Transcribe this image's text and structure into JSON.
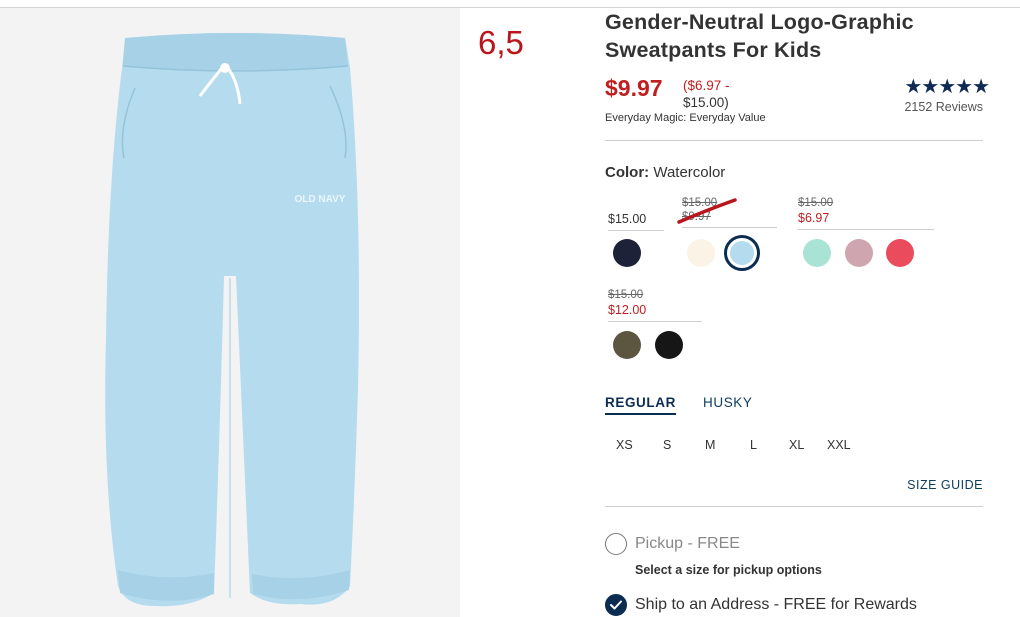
{
  "note": {
    "text": "6,5"
  },
  "product": {
    "title": "Gender-Neutral Logo-Graphic Sweatpants For Kids",
    "image_logo_text": "OLD NAVY",
    "price": "$9.97",
    "price_range_sale": "($6.97 -",
    "price_range_rest": "$15.00)",
    "tagline": "Everyday Magic: Everyday Value",
    "rating": {
      "stars": "★★★★★",
      "value": 5,
      "reviews": "2152 Reviews"
    }
  },
  "color": {
    "label": "Color:",
    "selected": "Watercolor",
    "groups": [
      {
        "regular": "$15.00"
      },
      {
        "original": "$15.00",
        "sale": "$9.97"
      },
      {
        "original": "$15.00",
        "sale": "$6.97"
      },
      {
        "original": "$15.00",
        "sale": "$12.00"
      }
    ],
    "swatches": [
      {
        "color": "#1d2238"
      },
      {
        "color": "#fbf3e6"
      },
      {
        "color": "#b5dbee",
        "selected": true
      },
      {
        "color": "#a9e3d6"
      },
      {
        "color": "#cfa6b0"
      },
      {
        "color": "#ea4b5d"
      },
      {
        "color": "#5c5640"
      },
      {
        "color": "#161616"
      }
    ]
  },
  "fit": {
    "tabs": [
      {
        "label": "REGULAR",
        "active": true
      },
      {
        "label": "HUSKY",
        "active": false
      }
    ]
  },
  "sizes": [
    "XS",
    "S",
    "M",
    "L",
    "XL",
    "XXL"
  ],
  "size_guide": "SIZE GUIDE",
  "fulfillment": {
    "pickup": {
      "label": "Pickup - FREE",
      "hint": "Select a size for pickup options",
      "checked": false
    },
    "ship": {
      "label": "Ship to an Address - FREE for Rewards",
      "checked": true
    }
  },
  "colors": {
    "accent": "#0b2d51",
    "sale": "#c11f1f",
    "annotation": "#b8161c",
    "pants": "#b5dbee"
  }
}
